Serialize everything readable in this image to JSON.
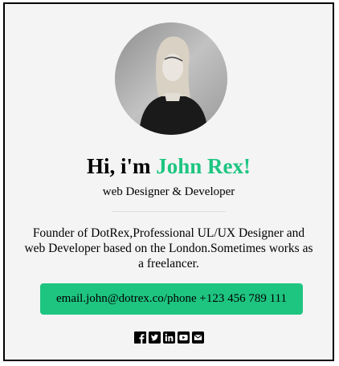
{
  "profile": {
    "greeting": "Hi, i'm ",
    "name": "John Rex!",
    "role": "web Designer & Developer",
    "bio": "Founder of DotRex,Professional UL/UX Designer and web Developer based on the London.Sometimes works as a freelancer.",
    "contact": "email.john@dotrex.co/phone +123 456 789 111"
  },
  "social_icons": [
    "facebook-icon",
    "twitter-icon",
    "linkedin-icon",
    "youtube-icon",
    "envelope-icon"
  ],
  "colors": {
    "accent": "#1ec581",
    "card_background": "#f4f4f4",
    "border": "#000000"
  }
}
